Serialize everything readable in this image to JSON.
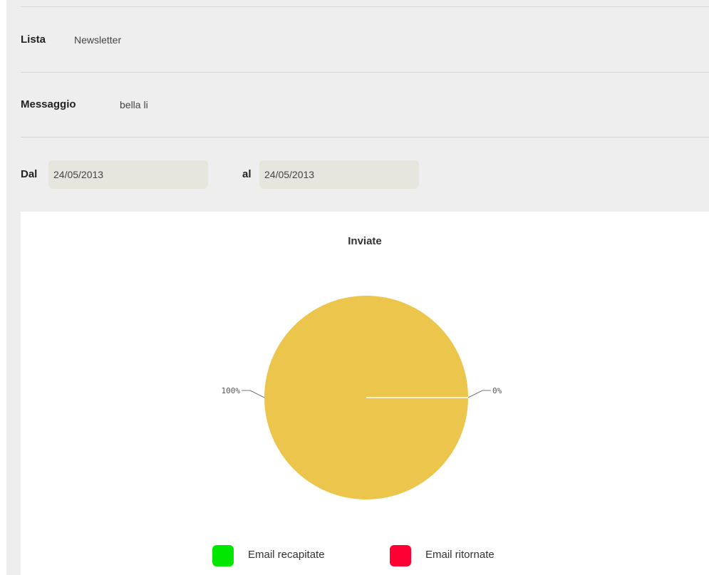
{
  "filters": {
    "lista": {
      "label": "Lista",
      "value": "Newsletter"
    },
    "messaggio": {
      "label": "Messaggio",
      "value": "bella li"
    },
    "dal": {
      "label": "Dal",
      "value": "24/05/2013"
    },
    "al": {
      "label": "al",
      "value": "24/05/2013"
    }
  },
  "chart_data": {
    "type": "pie",
    "title": "Inviate",
    "slices": [
      {
        "label": "Email recapitate",
        "value": 0,
        "percent_label": "0%",
        "color": "#00e600"
      },
      {
        "label": "Email ritornate",
        "value": 0,
        "percent_label": "",
        "color": "#ff0033"
      },
      {
        "label": "",
        "value": 100,
        "percent_label": "100%",
        "color": "#ecc54c"
      }
    ],
    "legend": {
      "position": "bottom",
      "items": [
        {
          "label": "Email recapitate",
          "color": "#00e600"
        },
        {
          "label": "Email ritornate",
          "color": "#ff0033"
        }
      ]
    }
  }
}
